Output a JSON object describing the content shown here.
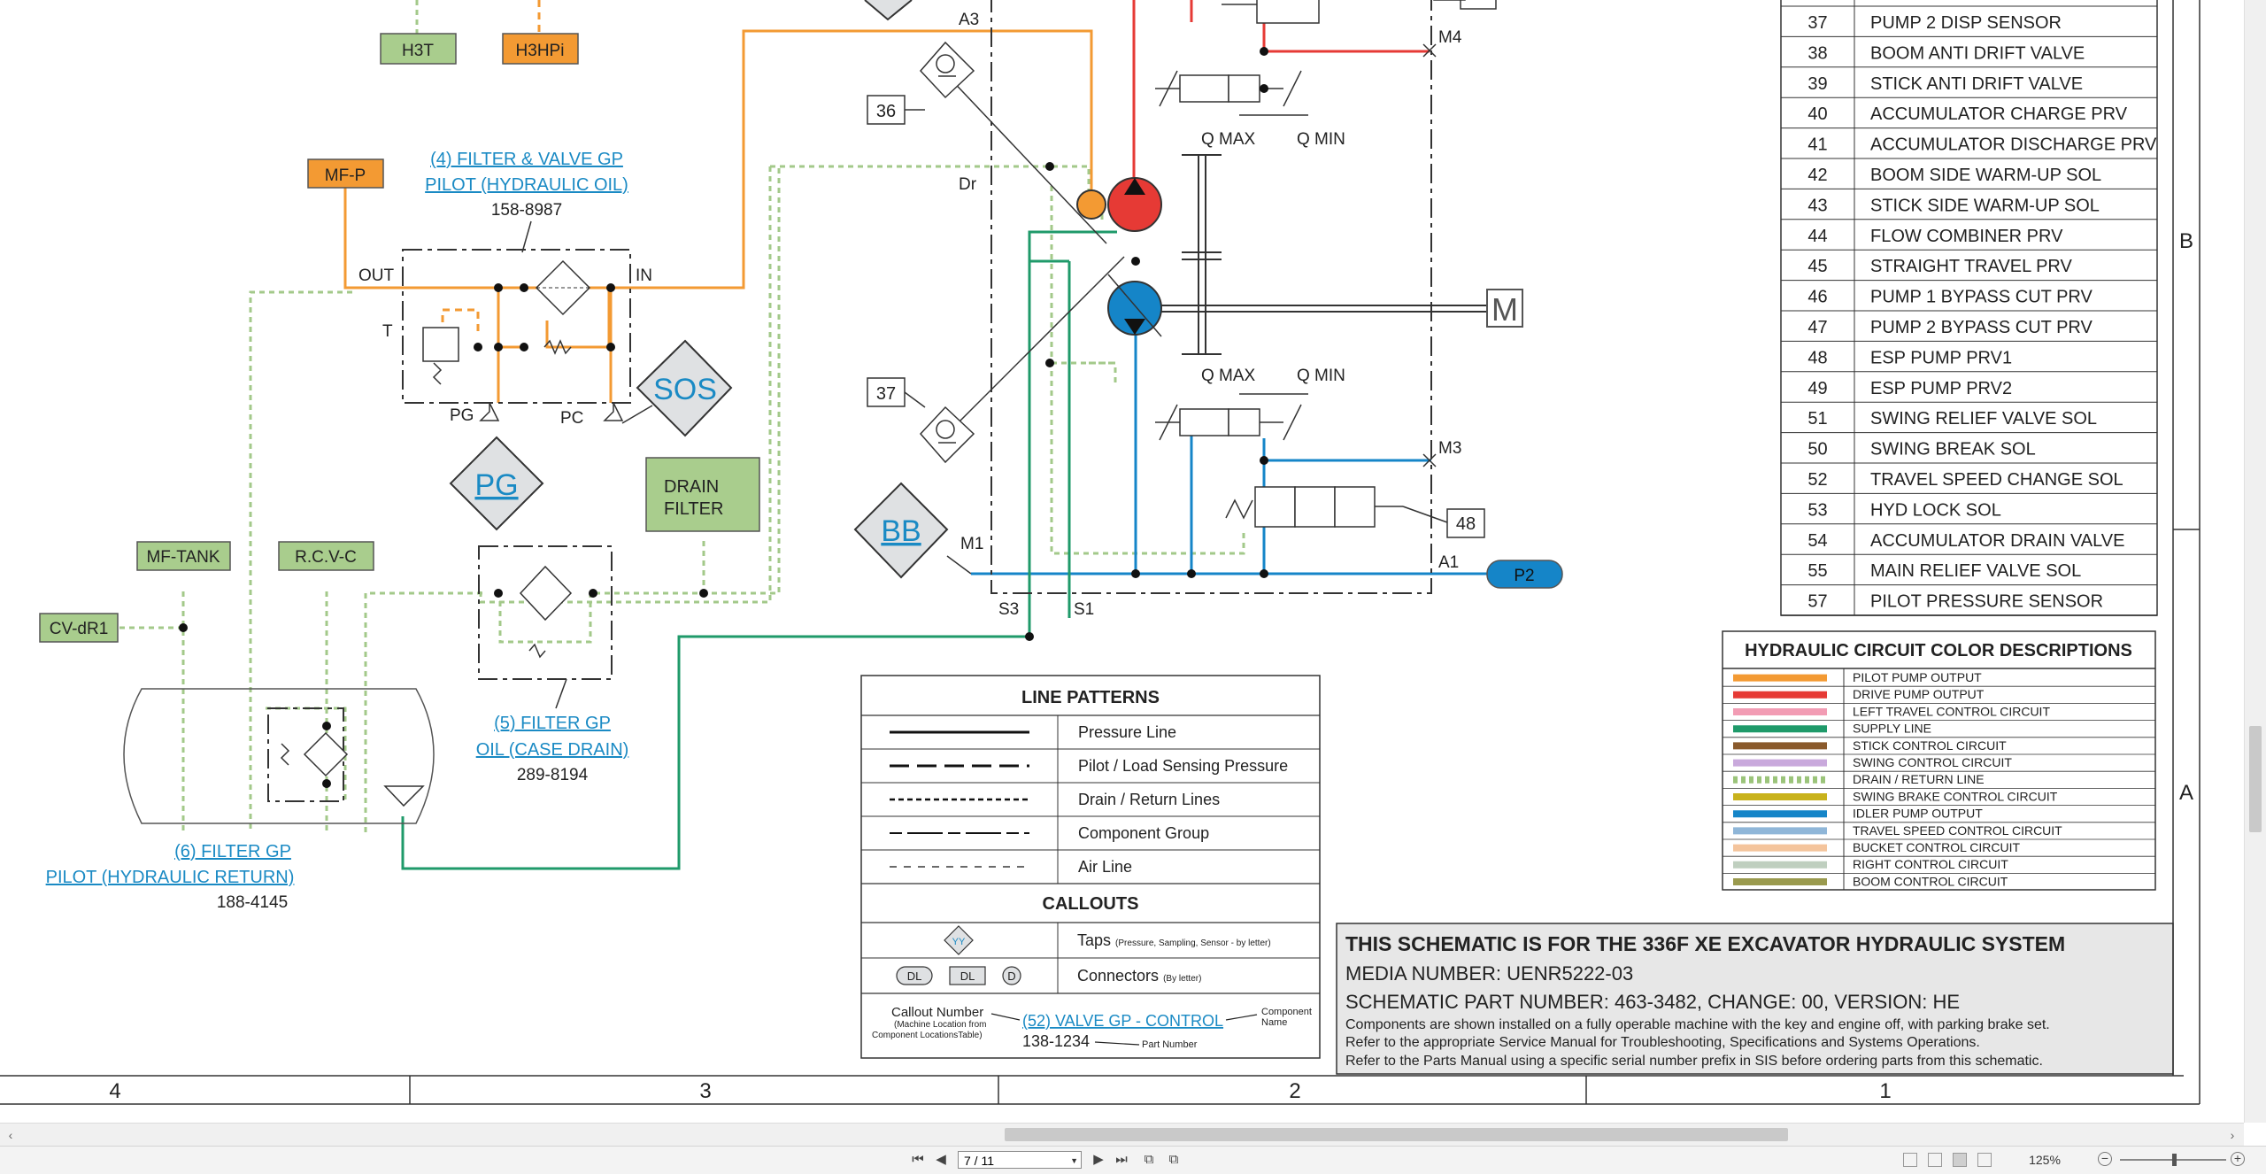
{
  "schematic": {
    "tags": {
      "h3t": "H3T",
      "h3hpi": "H3HPi",
      "mfp": "MF-P",
      "mftank": "MF-TANK",
      "rcvc": "R.C.V-C",
      "cvdr1": "CV-dR1",
      "drain_filter": [
        "DRAIN",
        "FILTER"
      ],
      "p2": "P2"
    },
    "taps": {
      "sos": "SOS",
      "pg": "PG",
      "bb": "BB"
    },
    "callouts": {
      "filter_valve_gp": {
        "name": [
          "(4) FILTER & VALVE GP",
          "PILOT (HYDRAULIC OIL)"
        ],
        "part": "158-8987"
      },
      "filter_gp_oil": {
        "name": [
          "(5) FILTER GP",
          "OIL (CASE DRAIN)"
        ],
        "part": "289-8194"
      },
      "filter_gp_pilot": {
        "name": [
          "(6) FILTER GP",
          "PILOT (HYDRAULIC RETURN)"
        ],
        "part": "188-4145"
      }
    },
    "labels": {
      "out": "OUT",
      "in": "IN",
      "t": "T",
      "pg_port": "PG",
      "pc_port": "PC",
      "a3": "A3",
      "dr": "Dr",
      "m1": "M1",
      "s3": "S3",
      "s1": "S1",
      "a1": "A1",
      "m4": "M4",
      "m3": "M3",
      "qmax": "Q MAX",
      "qmin": "Q MIN",
      "motor": "M",
      "box36": "36",
      "box37": "37",
      "box48": "48"
    }
  },
  "component_table": [
    {
      "num": "37",
      "name": "PUMP 2 DISP SENSOR"
    },
    {
      "num": "38",
      "name": "BOOM ANTI DRIFT VALVE"
    },
    {
      "num": "39",
      "name": "STICK ANTI DRIFT VALVE"
    },
    {
      "num": "40",
      "name": "ACCUMULATOR CHARGE PRV"
    },
    {
      "num": "41",
      "name": "ACCUMULATOR DISCHARGE PRV"
    },
    {
      "num": "42",
      "name": "BOOM SIDE WARM-UP SOL"
    },
    {
      "num": "43",
      "name": "STICK SIDE WARM-UP SOL"
    },
    {
      "num": "44",
      "name": "FLOW COMBINER PRV"
    },
    {
      "num": "45",
      "name": "STRAIGHT TRAVEL PRV"
    },
    {
      "num": "46",
      "name": "PUMP 1 BYPASS CUT PRV"
    },
    {
      "num": "47",
      "name": "PUMP 2 BYPASS CUT PRV"
    },
    {
      "num": "48",
      "name": "ESP PUMP PRV1"
    },
    {
      "num": "49",
      "name": "ESP PUMP PRV2"
    },
    {
      "num": "51",
      "name": "SWING RELIEF VALVE SOL"
    },
    {
      "num": "50",
      "name": "SWING BREAK SOL"
    },
    {
      "num": "52",
      "name": "TRAVEL SPEED CHANGE SOL"
    },
    {
      "num": "53",
      "name": "HYD LOCK SOL"
    },
    {
      "num": "54",
      "name": "ACCUMULATOR DRAIN VALVE"
    },
    {
      "num": "55",
      "name": "MAIN RELIEF VALVE SOL"
    },
    {
      "num": "57",
      "name": "PILOT PRESSURE SENSOR"
    }
  ],
  "color_legend": {
    "title": "HYDRAULIC CIRCUIT COLOR DESCRIPTIONS",
    "items": [
      {
        "color": "#f39a33",
        "label": "PILOT PUMP OUTPUT",
        "style": "solid"
      },
      {
        "color": "#e63a35",
        "label": "DRIVE PUMP OUTPUT",
        "style": "solid"
      },
      {
        "color": "#f29cb4",
        "label": "LEFT TRAVEL CONTROL CIRCUIT",
        "style": "solid"
      },
      {
        "color": "#1f9a6a",
        "label": "SUPPLY LINE",
        "style": "solid"
      },
      {
        "color": "#8a5a2c",
        "label": "STICK CONTROL CIRCUIT",
        "style": "solid"
      },
      {
        "color": "#c9a9dc",
        "label": "SWING CONTROL CIRCUIT",
        "style": "solid"
      },
      {
        "color": "#9bc47a",
        "label": "DRAIN / RETURN LINE",
        "style": "dotted"
      },
      {
        "color": "#c8b21c",
        "label": "SWING BRAKE CONTROL CIRCUIT",
        "style": "solid"
      },
      {
        "color": "#1585c8",
        "label": "IDLER PUMP OUTPUT",
        "style": "solid"
      },
      {
        "color": "#8fb6d8",
        "label": "TRAVEL SPEED CONTROL CIRCUIT",
        "style": "solid"
      },
      {
        "color": "#f4c49c",
        "label": "BUCKET CONTROL CIRCUIT",
        "style": "solid"
      },
      {
        "color": "#bfcfbf",
        "label": "RIGHT CONTROL CIRCUIT",
        "style": "solid"
      },
      {
        "color": "#9a9a4e",
        "label": "BOOM CONTROL CIRCUIT",
        "style": "solid"
      }
    ]
  },
  "line_patterns": {
    "title": "LINE PATTERNS",
    "items": [
      {
        "label": "Pressure Line",
        "dash": "solid"
      },
      {
        "label": "Pilot / Load Sensing Pressure",
        "dash": "long"
      },
      {
        "label": "Drain / Return Lines",
        "dash": "short"
      },
      {
        "label": "Component Group",
        "dash": "group"
      },
      {
        "label": "Air Line",
        "dash": "air"
      }
    ],
    "callouts_title": "CALLOUTS",
    "taps_label": "Taps",
    "taps_note": "(Pressure, Sampling, Sensor - by letter)",
    "taps_symbol": "YY",
    "connectors_label": "Connectors",
    "connectors_note": "(By letter)",
    "connector_symbols": [
      "DL",
      "DL",
      "D"
    ],
    "callout_number_label": "Callout Number",
    "callout_number_note": [
      "(Machine Location from",
      "Component LocationsTable)"
    ],
    "example_component": "(52) VALVE GP - CONTROL",
    "component_name_label": [
      "Component",
      "Name"
    ],
    "example_part": "138-1234",
    "part_number_label": "Part Number"
  },
  "title_block": {
    "line1": "THIS SCHEMATIC IS FOR THE 336F XE EXCAVATOR HYDRAULIC SYSTEM",
    "line2": "MEDIA NUMBER: UENR5222-03",
    "line3": "SCHEMATIC PART NUMBER: 463-3482, CHANGE: 00, VERSION: HE",
    "notes": [
      "Components are shown installed on a fully operable machine with the key and engine off, with parking brake set.",
      "Refer to the appropriate Service Manual for Troubleshooting, Specifications and Systems Operations.",
      "Refer to the Parts Manual using a specific serial number prefix in SIS before ordering parts from this schematic."
    ]
  },
  "grid": {
    "columns": [
      "4",
      "3",
      "2",
      "1"
    ],
    "rows": [
      "B",
      "A"
    ]
  },
  "viewer": {
    "page": "7 / 11",
    "zoom": "125%"
  }
}
